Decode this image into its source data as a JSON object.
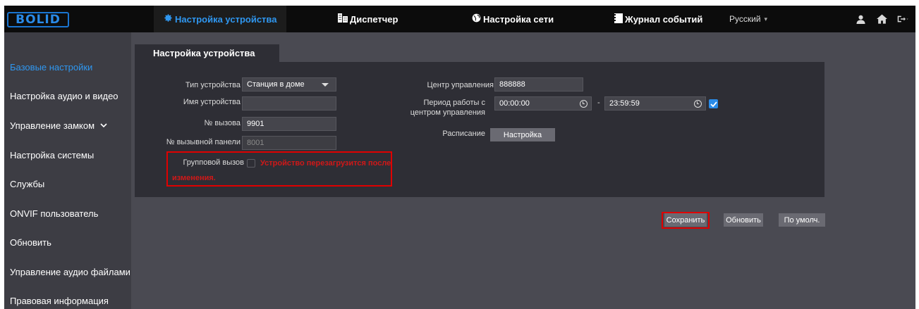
{
  "brand": {
    "logo_text": "BOLID"
  },
  "topnav": {
    "items": [
      {
        "label": "Настройка устройства",
        "icon": "gear-icon"
      },
      {
        "label": "Диспетчер",
        "icon": "building-icon"
      },
      {
        "label": "Настройка сети",
        "icon": "globe-icon"
      },
      {
        "label": "Журнал событий",
        "icon": "log-icon"
      }
    ],
    "language": "Русский",
    "icons": [
      "user-icon",
      "home-icon",
      "logout-icon"
    ]
  },
  "sidebar": {
    "items": [
      {
        "label": "Базовые настройки"
      },
      {
        "label": "Настройка аудио и видео"
      },
      {
        "label": "Управление замком"
      },
      {
        "label": "Настройка системы"
      },
      {
        "label": "Службы"
      },
      {
        "label": "ONVIF пользователь"
      },
      {
        "label": "Обновить"
      },
      {
        "label": "Управление аудио файлами"
      },
      {
        "label": "Правовая информация"
      }
    ]
  },
  "tab": {
    "label": "Настройка устройства"
  },
  "form": {
    "device_type_label": "Тип устройства",
    "device_type_value": "Станция в доме",
    "device_name_label": "Имя устройства",
    "device_name_value": "",
    "call_number_label": "№ вызова",
    "call_number_value": "9901",
    "panel_number_label": "№ вызывной панели",
    "panel_number_value": "8001",
    "group_call_label": "Групповой вызов",
    "group_call_warning": "Устройство перезагрузится после изменения.",
    "control_center_label": "Центр управления",
    "control_center_value": "888888",
    "period_label_line1": "Период работы с",
    "period_label_line2": "центром управления",
    "period_start": "00:00:00",
    "period_separator": "-",
    "period_end": "23:59:59",
    "schedule_label": "Расписание",
    "schedule_button": "Настройка"
  },
  "actions": {
    "save": "Сохранить",
    "refresh": "Обновить",
    "default": "По умолч."
  },
  "colors": {
    "accent": "#2f97f0",
    "warning": "#e00000",
    "background": "#4a4a52",
    "panel": "#2e2e35",
    "topbar": "#0c0c0c"
  }
}
